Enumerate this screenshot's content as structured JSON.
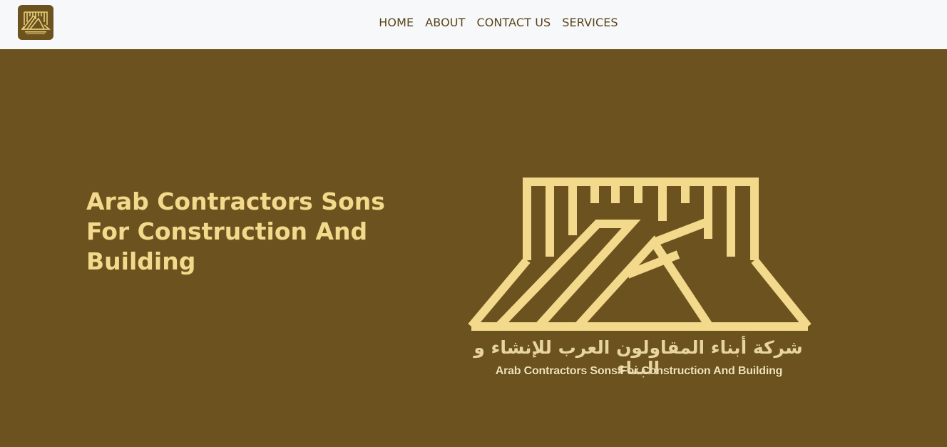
{
  "header": {
    "logo_icon": "company-logo-icon",
    "nav": [
      {
        "label": "HOME"
      },
      {
        "label": "ABOUT"
      },
      {
        "label": "CONTACT US"
      },
      {
        "label": "SERVICES"
      }
    ]
  },
  "hero": {
    "title": "Arab Contractors Sons For Construction And Building",
    "logo": {
      "arabic_name": "شركة أبناء المقاولون العرب للإنشاء و البناء",
      "english_name": "Arab Contractors Sons For Construction And Building"
    }
  },
  "colors": {
    "brand_brown": "#6c521e",
    "gold": "#f3d98b",
    "header_bg": "#f7f8fa"
  }
}
